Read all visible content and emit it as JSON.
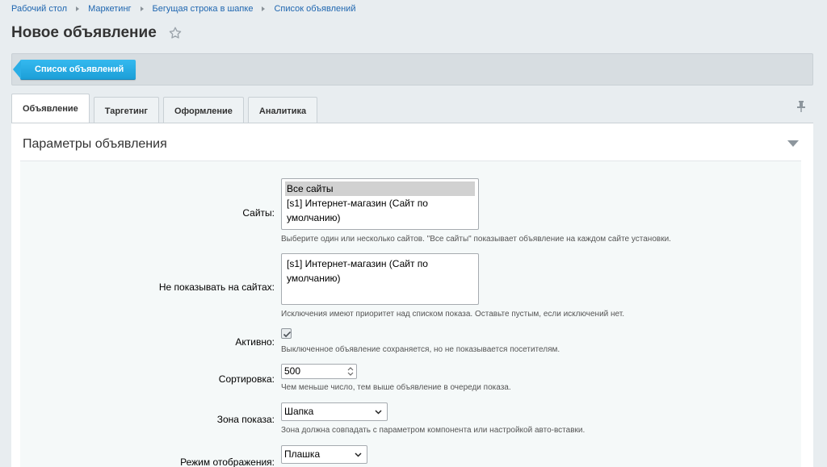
{
  "breadcrumb": [
    "Рабочий стол",
    "Маркетинг",
    "Бегущая строка в шапке",
    "Список объявлений"
  ],
  "page_title": "Новое объявление",
  "toolbar": {
    "back_label": "Список объявлений"
  },
  "tabs": [
    {
      "label": "Объявление",
      "active": true
    },
    {
      "label": "Таргетинг"
    },
    {
      "label": "Оформление"
    },
    {
      "label": "Аналитика"
    }
  ],
  "section": {
    "title": "Параметры объявления"
  },
  "form": {
    "sites": {
      "label": "Сайты:",
      "options": [
        "Все сайты",
        "[s1] Интернет-магазин (Сайт по умолчанию)"
      ],
      "hint": "Выберите один или несколько сайтов. \"Все сайты\" показывает объявление на каждом сайте установки."
    },
    "exclude_sites": {
      "label": "Не показывать на сайтах:",
      "options": [
        "[s1] Интернет-магазин (Сайт по умолчанию)"
      ],
      "hint": "Исключения имеют приоритет над списком показа. Оставьте пустым, если исключений нет."
    },
    "active": {
      "label": "Активно:",
      "checked": true,
      "hint": "Выключенное объявление сохраняется, но не показывается посетителям."
    },
    "sort": {
      "label": "Сортировка:",
      "value": "500",
      "hint": "Чем меньше число, тем выше объявление в очереди показа."
    },
    "zone": {
      "label": "Зона показа:",
      "value": "Шапка",
      "hint": "Зона должна совпадать с параметром компонента или настройкой авто-вставки."
    },
    "display_mode": {
      "label": "Режим отображения:",
      "value": "Плашка"
    }
  },
  "colors": {
    "accent": "#2aaee6",
    "link": "#2067b0",
    "background": "#e8edf0"
  }
}
